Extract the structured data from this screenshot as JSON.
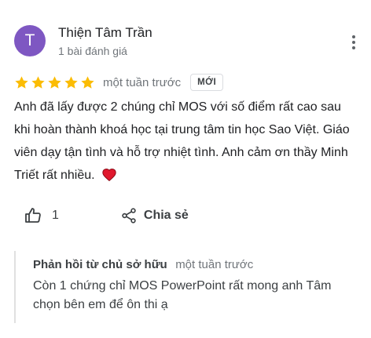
{
  "author": {
    "initial": "T",
    "name": "Thiện Tâm Trần",
    "meta": "1 bài đánh giá",
    "avatar_color": "#7e57c2"
  },
  "rating": {
    "stars": 5,
    "max_stars": 5,
    "star_color": "#fbbc04",
    "time": "một tuần trước",
    "badge": "MỚI"
  },
  "review": {
    "text": "Anh đã lấy được 2 chúng chỉ MOS với số điểm rất cao sau khi hoàn thành khoá học tại trung tâm tin học Sao Việt. Giáo viên dạy tận tình và hỗ trợ nhiệt tình. Anh cảm ơn thầy Minh Triết rất nhiều.",
    "emoji_icon": "red-heart-icon"
  },
  "actions": {
    "like_icon": "thumb-up-icon",
    "like_count": "1",
    "share_icon": "share-icon",
    "share_label": "Chia sẻ"
  },
  "owner_reply": {
    "author": "Phản hồi từ chủ sở hữu",
    "time": "một tuần trước",
    "text": "Còn 1 chứng chỉ MOS PowerPoint rất mong anh Tâm chọn bên em để ôn thi ạ"
  },
  "menu_icon": "more-vert-icon"
}
